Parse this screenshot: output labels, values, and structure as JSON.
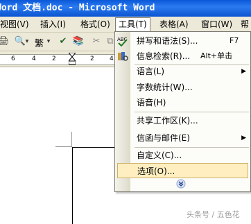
{
  "window": {
    "title": "Word 文档.doc - Microsoft Word"
  },
  "menubar": {
    "items": [
      {
        "label": "视图(V)"
      },
      {
        "label": "插入(I)"
      },
      {
        "label": "格式(O)"
      },
      {
        "label": "工具(T)"
      },
      {
        "label": "表格(A)"
      },
      {
        "label": "窗口(W)"
      },
      {
        "label": "帮"
      }
    ]
  },
  "toolbar": {
    "style_label": "繁"
  },
  "ruler": {
    "numbers": [
      "6",
      "4",
      "2",
      "2",
      "4",
      "6"
    ]
  },
  "tools_menu": {
    "items": [
      {
        "label": "拼写和语法(S)...",
        "shortcut": "F7",
        "icon": "spelling-check-icon"
      },
      {
        "label": "信息检索(R)...",
        "shortcut": "Alt+单击",
        "icon": "research-icon"
      },
      {
        "label": "语言(L)",
        "submenu": true
      },
      {
        "label": "字数统计(W)..."
      },
      {
        "label": "语音(H)"
      },
      {
        "label": "共享工作区(K)..."
      },
      {
        "label": "信函与邮件(E)",
        "submenu": true
      },
      {
        "label": "自定义(C)..."
      },
      {
        "label": "选项(O)...",
        "highlighted": true
      }
    ]
  },
  "watermark": "头条号 / 五色花",
  "colors": {
    "title_bar": "#0b55d0",
    "highlight": "#ffefc0",
    "menu_bg": "#ece9d8"
  }
}
